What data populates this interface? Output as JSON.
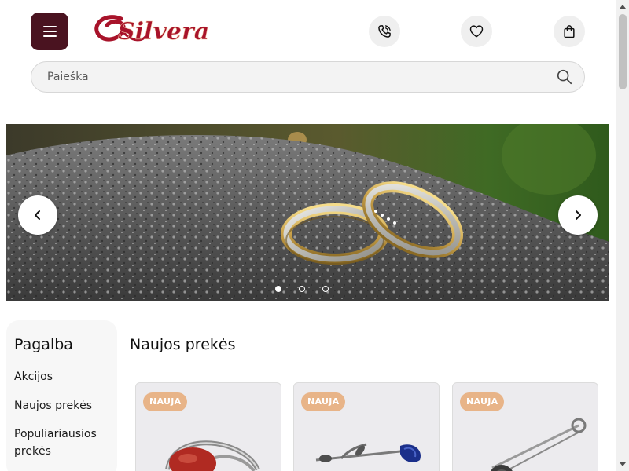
{
  "header": {
    "logo_text": "Silvera",
    "icons": [
      "menu-icon",
      "phone-icon",
      "heart-icon",
      "shopping-bag-icon"
    ]
  },
  "search": {
    "placeholder": "Paieška",
    "value": ""
  },
  "banner": {
    "slide_count": 3,
    "active_slide": 1
  },
  "sidebar": {
    "title": "Pagalba",
    "items": [
      {
        "label": "Akcijos"
      },
      {
        "label": "Naujos prekės"
      },
      {
        "label": "Populiariausios prekės"
      }
    ]
  },
  "products": {
    "title": "Naujos prekės",
    "items": [
      {
        "badge": "NAUJA"
      },
      {
        "badge": "NAUJA"
      },
      {
        "badge": "NAUJA"
      }
    ]
  },
  "colors": {
    "brand": "#4a1320",
    "logo_red": "#a8132a",
    "badge": "#e8b488"
  }
}
